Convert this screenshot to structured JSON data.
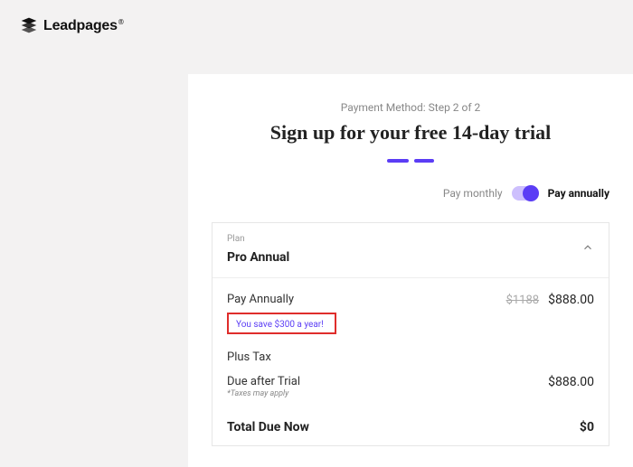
{
  "brand": {
    "name": "Leadpages"
  },
  "step": "Payment Method: Step 2 of 2",
  "title": "Sign up for your free 14-day trial",
  "billing": {
    "monthly_label": "Pay monthly",
    "annually_label": "Pay annually"
  },
  "plan": {
    "label": "Plan",
    "name": "Pro Annual"
  },
  "rows": {
    "pay_annually_label": "Pay Annually",
    "price_original": "$1188",
    "price_current": "$888.00",
    "savings": "You save $300 a year!",
    "plus_tax": "Plus Tax",
    "due_after_trial_label": "Due after Trial",
    "due_after_trial_value": "$888.00",
    "taxes_note": "*Taxes may apply",
    "total_label": "Total Due Now",
    "total_value": "$0"
  }
}
